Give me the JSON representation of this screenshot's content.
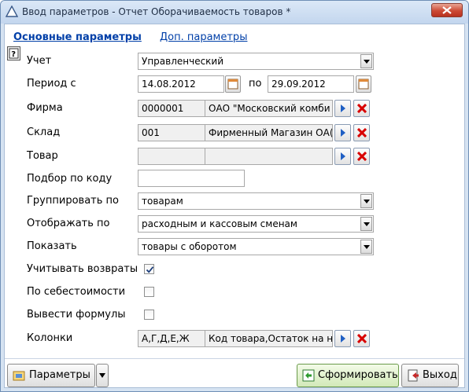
{
  "window": {
    "title": "Ввод параметров - Отчет Оборачиваемость товаров *"
  },
  "tabs": [
    {
      "label": "Основные параметры",
      "active": true
    },
    {
      "label": "Доп. параметры",
      "active": false
    }
  ],
  "fields": {
    "uchet": {
      "label": "Учет",
      "value": "Управленческий"
    },
    "period": {
      "label": "Период с",
      "from": "14.08.2012",
      "sep": "по",
      "to": "29.09.2012"
    },
    "firma": {
      "label": "Фирма",
      "code": "0000001",
      "name": "ОАО \"Московский комби"
    },
    "sklad": {
      "label": "Склад",
      "code": "001",
      "name": "Фирменный Магазин ОА("
    },
    "tovar": {
      "label": "Товар",
      "code": "",
      "name": ""
    },
    "podbor": {
      "label": "Подбор по коду",
      "value": ""
    },
    "gruppirovat": {
      "label": "Группировать по",
      "value": "товарам"
    },
    "otobrazhat": {
      "label": "Отображать по",
      "value": "расходным и кассовым сменам"
    },
    "pokazat": {
      "label": "Показать",
      "value": "товары с оборотом"
    },
    "vozvraty": {
      "label": "Учитывать возвраты",
      "checked": true
    },
    "sebestoimost": {
      "label": "По себестоимости",
      "checked": false
    },
    "formuly": {
      "label": "Вывести формулы",
      "checked": false
    },
    "kolonki": {
      "label": "Колонки",
      "code": "А,Г,Д,Е,Ж",
      "name": "Код товара,Остаток на н"
    }
  },
  "footer": {
    "params_label": "Параметры",
    "generate_label": "Сформировать",
    "exit_label": "Выход"
  },
  "colors": {
    "link": "#003fa8",
    "clear_x": "#d80000",
    "pick_arrow": "#1f5fc4"
  }
}
